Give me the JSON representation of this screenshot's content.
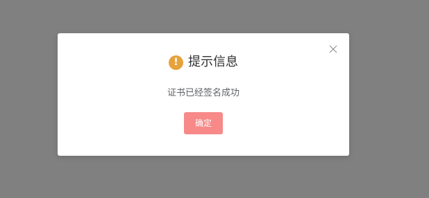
{
  "dialog": {
    "title": "提示信息",
    "message": "证书已经签名成功",
    "confirm_label": "确定",
    "icon": "warning-icon",
    "icon_glyph": "!",
    "close_icon": "close-icon"
  },
  "colors": {
    "overlay": "#808080",
    "warning": "#e6a23c",
    "confirm_button": "#f78989"
  }
}
